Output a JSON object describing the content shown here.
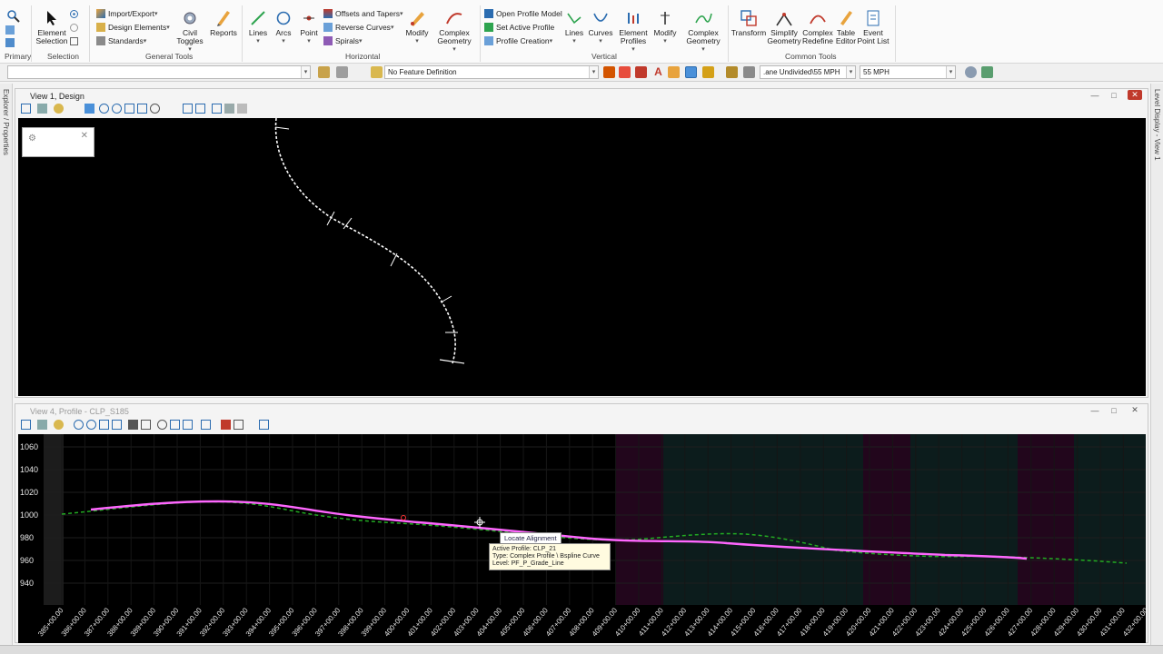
{
  "ribbon": {
    "primary_group": "Primary",
    "selection_group": "Selection",
    "element_selection": "Element\nSelection",
    "general_tools_group": "General Tools",
    "import_export": "Import/Export",
    "design_elements": "Design Elements",
    "standards": "Standards",
    "civil_toggles": "Civil\nToggles",
    "reports": "Reports",
    "horizontal_group": "Horizontal",
    "lines": "Lines",
    "arcs": "Arcs",
    "point": "Point",
    "offsets_tapers": "Offsets and Tapers",
    "reverse_curves": "Reverse Curves",
    "spirals": "Spirals",
    "modify": "Modify",
    "complex_geometry": "Complex\nGeometry",
    "vertical_group": "Vertical",
    "open_profile_model": "Open Profile Model",
    "set_active_profile": "Set Active Profile",
    "profile_creation": "Profile Creation",
    "v_lines": "Lines",
    "v_curves": "Curves",
    "element_profiles": "Element\nProfiles",
    "v_modify": "Modify",
    "v_complex_geometry": "Complex\nGeometry",
    "common_tools_group": "Common Tools",
    "transform": "Transform",
    "simplify_geometry": "Simplify\nGeometry",
    "complex_redefine": "Complex\nRedefine",
    "table_editor": "Table\nEditor",
    "event_point_list": "Event\nPoint List"
  },
  "attrbar": {
    "feature_definition": "No Feature Definition",
    "design_standard": ".ane Undivided\\55 MPH",
    "speed": "55 MPH"
  },
  "side": {
    "left_label": "Explorer / Properties",
    "right_label": "Level Display - View 1"
  },
  "view1": {
    "title": "View 1, Design"
  },
  "view4": {
    "title": "View 4, Profile - CLP_S185",
    "y_ticks": [
      "1060",
      "1040",
      "1020",
      "1000",
      "980",
      "960",
      "940"
    ],
    "stations": [
      "385+00.00",
      "386+00.00",
      "387+00.00",
      "388+00.00",
      "389+00.00",
      "390+00.00",
      "391+00.00",
      "392+00.00",
      "393+00.00",
      "394+00.00",
      "395+00.00",
      "396+00.00",
      "397+00.00",
      "398+00.00",
      "399+00.00",
      "400+00.00",
      "401+00.00",
      "402+00.00",
      "403+00.00",
      "404+00.00",
      "405+00.00",
      "406+00.00",
      "407+00.00",
      "408+00.00",
      "409+00.00",
      "410+00.00",
      "411+00.00",
      "412+00.00",
      "413+00.00",
      "414+00.00",
      "415+00.00",
      "416+00.00",
      "417+00.00",
      "418+00.00",
      "419+00.00",
      "420+00.00",
      "421+00.00",
      "422+00.00",
      "423+00.00",
      "424+00.00",
      "425+00.00",
      "426+00.00",
      "427+00.00",
      "428+00.00",
      "429+00.00",
      "430+00.00",
      "431+00.00",
      "432+00.00"
    ]
  },
  "tooltip": {
    "header": "Locate Alignment",
    "line1": "Active Profile: CLP_21",
    "line2": "Type: Complex Profile \\ Bspline Curve",
    "line3": "Level: PF_P_Grade_Line"
  },
  "colors": {
    "active_profile": "#ff66ff",
    "existing_ground": "#22aa22",
    "alignment": "#ffffff",
    "view_background": "#000000"
  }
}
